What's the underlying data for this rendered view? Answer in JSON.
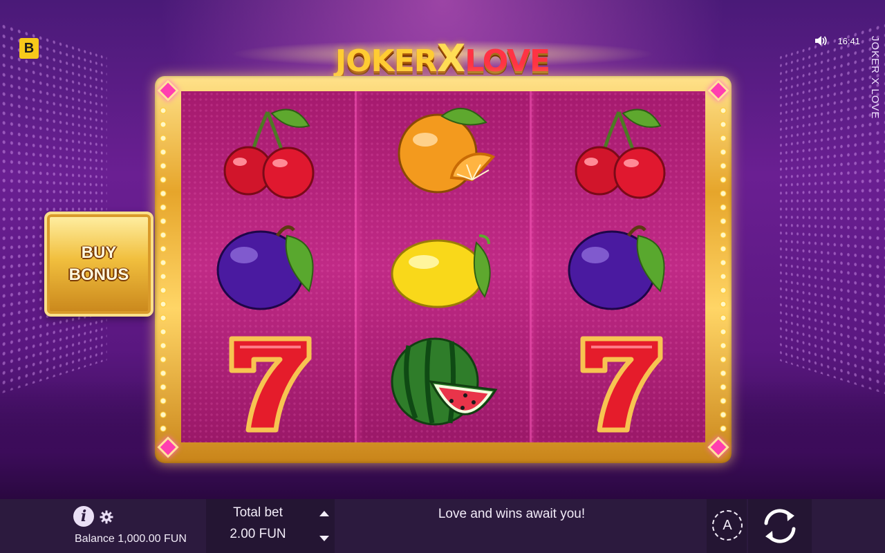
{
  "game": {
    "brand_letter": "B",
    "logo_part1": "JOKER",
    "logo_part2": "X",
    "logo_part3": "LOVE",
    "vertical_title": "JOKER X LOVE",
    "clock": "16:41"
  },
  "reels": [
    [
      "cherries",
      "plum",
      "seven"
    ],
    [
      "orange",
      "lemon",
      "watermelon"
    ],
    [
      "cherries",
      "plum",
      "seven"
    ]
  ],
  "buy_bonus": {
    "label": "BUY\nBONUS"
  },
  "bottom_bar": {
    "balance_text": "Balance 1,000.00 FUN",
    "total_bet_label": "Total bet",
    "total_bet_value": "2.00 FUN",
    "message": "Love and wins await you!",
    "auto_label": "A"
  },
  "icons": {
    "info": "info-icon",
    "settings": "gear-icon",
    "sound": "speaker-icon",
    "bet_up": "triangle-up-icon",
    "bet_down": "triangle-down-icon",
    "spin": "spin-arrows-icon"
  },
  "colors": {
    "reel_bg": "#b4217a",
    "frame_gold": "#e6a52b",
    "bar_bg": "#2c1a3e",
    "brand_yellow": "#f7c91a"
  }
}
